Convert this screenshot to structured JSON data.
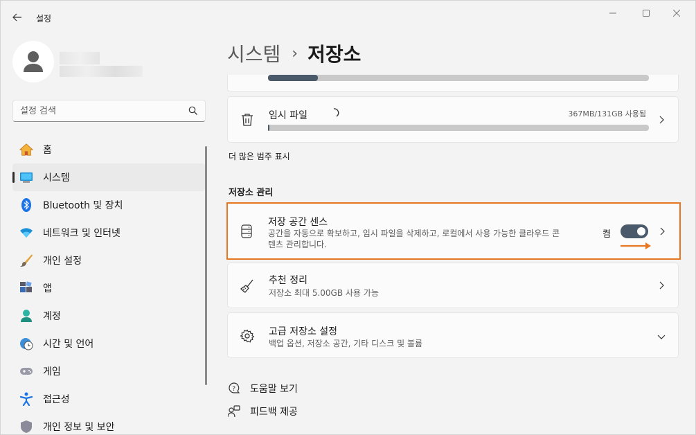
{
  "window": {
    "title": "설정"
  },
  "search": {
    "placeholder": "설정 검색"
  },
  "sidebar": {
    "items": [
      {
        "label": "홈",
        "icon": "home-icon"
      },
      {
        "label": "시스템",
        "icon": "system-icon",
        "selected": true
      },
      {
        "label": "Bluetooth 및 장치",
        "icon": "bluetooth-icon"
      },
      {
        "label": "네트워크 및 인터넷",
        "icon": "wifi-icon"
      },
      {
        "label": "개인 설정",
        "icon": "brush-icon"
      },
      {
        "label": "앱",
        "icon": "apps-icon"
      },
      {
        "label": "계정",
        "icon": "account-icon"
      },
      {
        "label": "시간 및 언어",
        "icon": "clock-globe-icon"
      },
      {
        "label": "게임",
        "icon": "gamepad-icon"
      },
      {
        "label": "접근성",
        "icon": "accessibility-icon"
      },
      {
        "label": "개인 정보 및 보안",
        "icon": "shield-icon"
      }
    ]
  },
  "breadcrumb": {
    "parent": "시스템",
    "separator": "›",
    "current": "저장소"
  },
  "storage": {
    "top_category": {
      "used_fraction": 0.13
    },
    "temp_files": {
      "title": "임시 파일",
      "usage": "367MB/131GB 사용됨",
      "used_fraction": 0.003
    },
    "more_categories_label": "더 많은 범주 표시"
  },
  "management": {
    "heading": "저장소 관리",
    "storage_sense": {
      "title": "저장 공간 센스",
      "description_line1": "공간을 자동으로 확보하고, 임시 파일을 삭제하고, 로컬에서 사용 가능한 클라우드 콘",
      "description_line2": "텐츠 관리합니다.",
      "toggle_label": "켬",
      "toggle_on": true
    },
    "cleanup": {
      "title": "추천 정리",
      "subtitle": "저장소 최대 5.00GB 사용 가능"
    },
    "advanced": {
      "title": "고급 저장소 설정",
      "subtitle": "백업 옵션, 저장소 공간, 기타 디스크 및 볼륨"
    }
  },
  "footer": {
    "help": "도움말 보기",
    "feedback": "피드백 제공"
  },
  "colors": {
    "accent": "#4a5a6a",
    "highlight": "#e87722"
  }
}
